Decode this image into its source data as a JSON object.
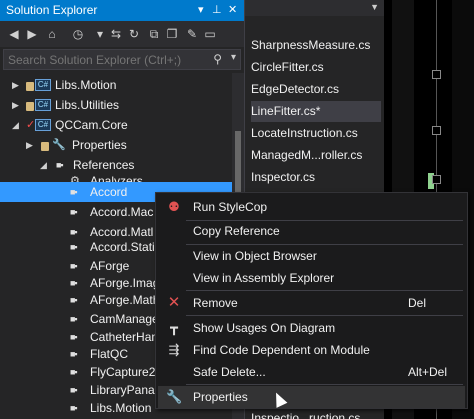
{
  "solution_explorer": {
    "title": "Solution Explorer",
    "controls": [
      "▾",
      "⊥",
      "✕"
    ],
    "search_placeholder": "Search Solution Explorer (Ctrl+;)",
    "tree": [
      {
        "label": "Libs.Motion",
        "icon": "csharp-project-icon"
      },
      {
        "label": "Libs.Utilities",
        "icon": "csharp-project-icon"
      },
      {
        "label": "QCCam.Core",
        "icon": "csharp-project-icon"
      },
      {
        "label": "Properties",
        "icon": "wrench-icon"
      },
      {
        "label": "References",
        "icon": "references-icon"
      },
      {
        "label": "Analyzers",
        "icon": "analyzers-icon"
      },
      {
        "label": "Accord",
        "icon": "reference-icon"
      },
      {
        "label": "Accord.Mac",
        "icon": "reference-icon"
      },
      {
        "label": "Accord.Matl",
        "icon": "reference-icon"
      },
      {
        "label": "Accord.Stati",
        "icon": "reference-icon"
      },
      {
        "label": "AForge",
        "icon": "reference-icon"
      },
      {
        "label": "AForge.Imag",
        "icon": "reference-icon"
      },
      {
        "label": "AForge.Math",
        "icon": "reference-icon"
      },
      {
        "label": "CamManage",
        "icon": "reference-icon"
      },
      {
        "label": "CatheterHan",
        "icon": "reference-icon"
      },
      {
        "label": "FlatQC",
        "icon": "reference-icon"
      },
      {
        "label": "FlyCapture2",
        "icon": "reference-icon"
      },
      {
        "label": "LibraryPanas",
        "icon": "reference-icon"
      },
      {
        "label": "Libs.Motion",
        "icon": "reference-icon"
      }
    ]
  },
  "files": {
    "items": [
      "SharpnessMeasure.cs",
      "CircleFitter.cs",
      "EdgeDetector.cs",
      "LineFitter.cs*",
      "LocateInstruction.cs",
      "ManagedM...roller.cs",
      "Inspector.cs",
      "Inspectio...ruction.cs"
    ],
    "highlighted": "LineFitter.cs*"
  },
  "context_menu": {
    "items": [
      {
        "label": "Run StyleCop",
        "shortcut": "",
        "icon": "stylecop-icon"
      },
      {
        "label": "Copy Reference",
        "shortcut": "",
        "icon": ""
      },
      {
        "label": "View in Object Browser",
        "shortcut": "",
        "icon": ""
      },
      {
        "label": "View in Assembly Explorer",
        "shortcut": "",
        "icon": ""
      },
      {
        "label": "Remove",
        "shortcut": "Del",
        "icon": "remove-icon"
      },
      {
        "label": "Show Usages On Diagram",
        "shortcut": "",
        "icon": "diagram-icon"
      },
      {
        "label": "Find Code Dependent on Module",
        "shortcut": "",
        "icon": "dependency-icon"
      },
      {
        "label": "Safe Delete...",
        "shortcut": "Alt+Del",
        "icon": ""
      },
      {
        "label": "Properties",
        "shortcut": "",
        "icon": "wrench-icon"
      }
    ]
  },
  "colors": {
    "title_bar": "#007acc",
    "selection": "#3399ff",
    "panel_bg": "#252526",
    "menu_bg": "#1b1b1c"
  }
}
